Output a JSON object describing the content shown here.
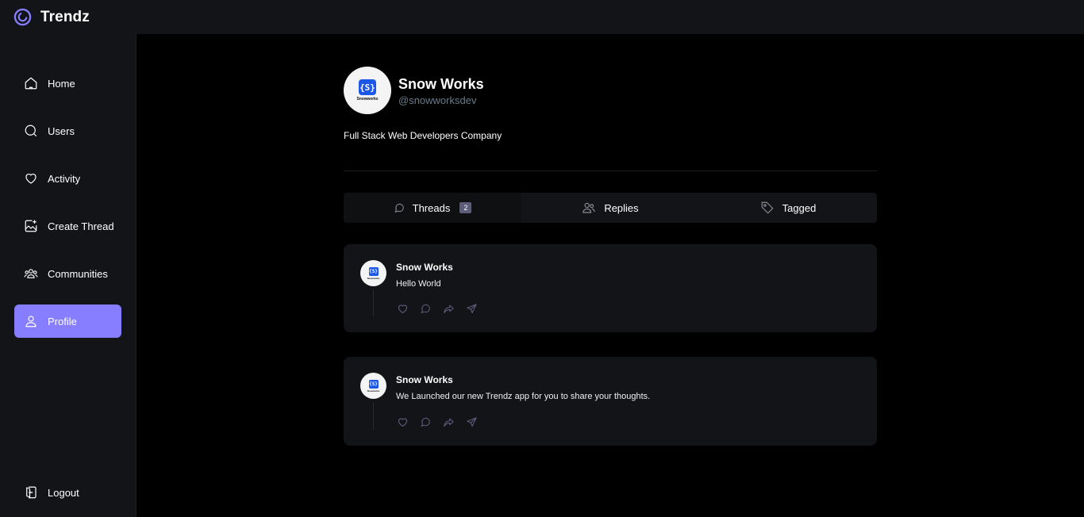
{
  "app": {
    "title": "Trendz"
  },
  "sidebar": {
    "items": [
      {
        "label": "Home",
        "icon": "home-icon"
      },
      {
        "label": "Users",
        "icon": "search-icon"
      },
      {
        "label": "Activity",
        "icon": "heart-icon"
      },
      {
        "label": "Create Thread",
        "icon": "create-thread-icon"
      },
      {
        "label": "Communities",
        "icon": "communities-icon"
      },
      {
        "label": "Profile",
        "icon": "user-icon",
        "active": true
      }
    ],
    "logout_label": "Logout"
  },
  "profile": {
    "name": "Snow Works",
    "handle": "@snowworksdev",
    "bio": "Full Stack Web Developers Company",
    "avatar_text": "Snowworks"
  },
  "tabs": [
    {
      "label": "Threads",
      "icon": "chat-bubble-icon",
      "count": "2",
      "active": true
    },
    {
      "label": "Replies",
      "icon": "members-icon"
    },
    {
      "label": "Tagged",
      "icon": "tag-icon"
    }
  ],
  "threads": [
    {
      "author": "Snow Works",
      "text": "Hello World"
    },
    {
      "author": "Snow Works",
      "text": "We Launched our new Trendz app for you to share your thoughts."
    }
  ],
  "colors": {
    "accent": "#877eff",
    "panel": "#121417",
    "handle": "#697c89"
  }
}
